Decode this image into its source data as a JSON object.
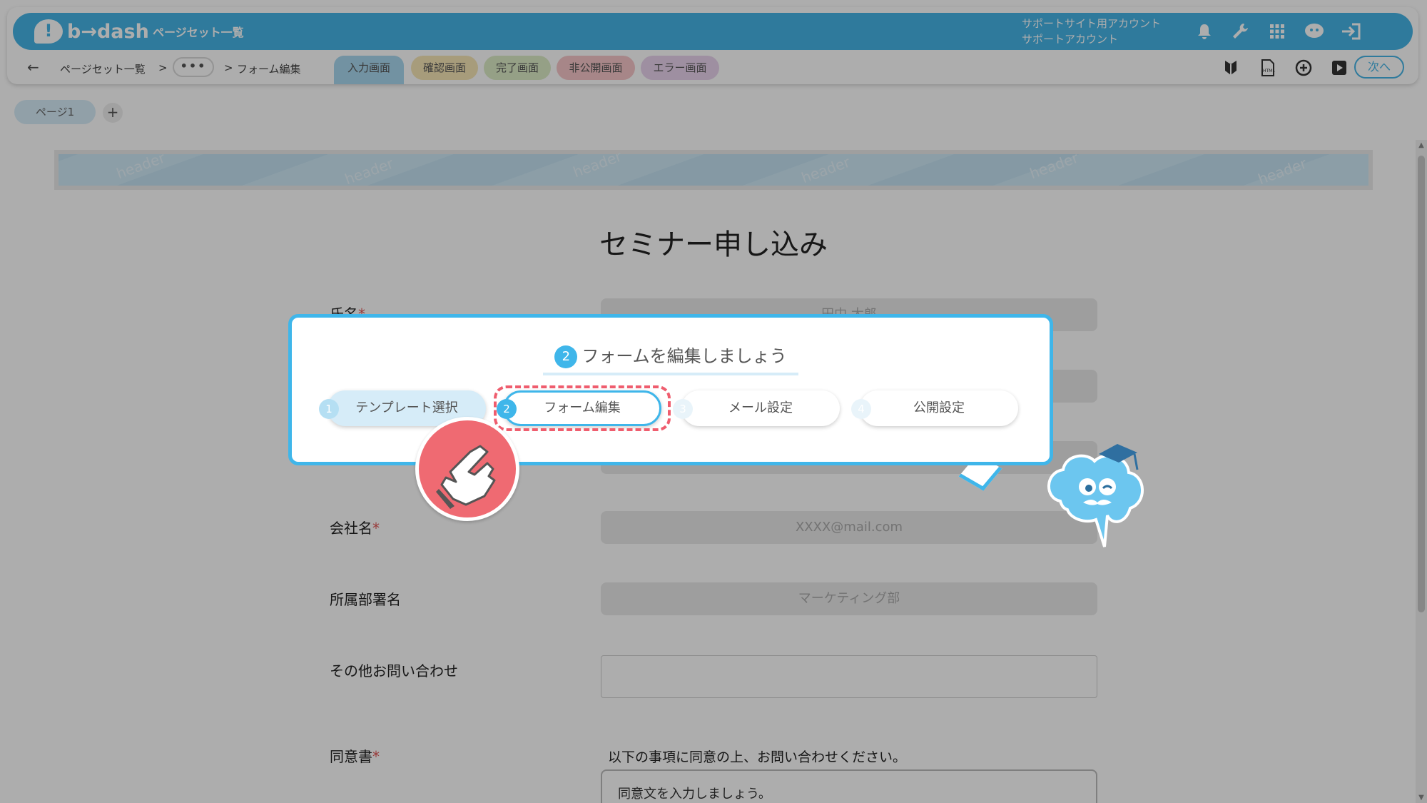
{
  "app": {
    "logo_text": "b→dash",
    "title": "ページセット一覧",
    "account_line1": "サポートサイト用アカウント",
    "account_line2": "サポートアカウント"
  },
  "icons": {
    "bell": "bell-icon",
    "wrench": "wrench-icon",
    "grid": "grid-icon",
    "mascot": "mascot-icon",
    "logout": "logout-icon"
  },
  "breadcrumb": {
    "back": "←",
    "item1": "ページセット一覧",
    "sep1": ">",
    "more": "•••",
    "sep2": ">",
    "item2": "フォーム編集"
  },
  "tabs": [
    {
      "label": "入力画面",
      "color": "#a9d8ef"
    },
    {
      "label": "確認画面",
      "color": "#f6e6b5"
    },
    {
      "label": "完了画面",
      "color": "#dcecc6"
    },
    {
      "label": "非公開画面",
      "color": "#f6c6c9"
    },
    {
      "label": "エラー画面",
      "color": "#e9d3ee"
    }
  ],
  "toolbar": {
    "next_label": "次へ"
  },
  "pages": {
    "tab1": "ページ1",
    "add": "+"
  },
  "canvas": {
    "header_word": "header",
    "form_title": "セミナー申し込み",
    "fields": [
      {
        "label": "氏名",
        "required": "*",
        "placeholder": "田中 太郎"
      },
      {
        "label": "会社名",
        "required": "*",
        "placeholder": "XXXX@mail.com"
      },
      {
        "label": "所属部署名",
        "required": "",
        "placeholder": "マーケティング部"
      },
      {
        "label": "その他お問い合わせ",
        "required": "",
        "placeholder": ""
      },
      {
        "label": "同意書",
        "required": "*",
        "placeholder": ""
      }
    ],
    "consent_text": "以下の事項に同意の上、お問い合わせください。",
    "consent_box": "同意文を入力しましょう。"
  },
  "tour": {
    "title_num": "2",
    "title": "フォームを編集しましょう",
    "steps": [
      {
        "num": "1",
        "label": "テンプレート選択"
      },
      {
        "num": "2",
        "label": "フォーム編集"
      },
      {
        "num": "3",
        "label": "メール設定"
      },
      {
        "num": "4",
        "label": "公開設定"
      }
    ]
  },
  "colors": {
    "brand": "#46b4e6",
    "accent_red": "#ef5d6e"
  }
}
